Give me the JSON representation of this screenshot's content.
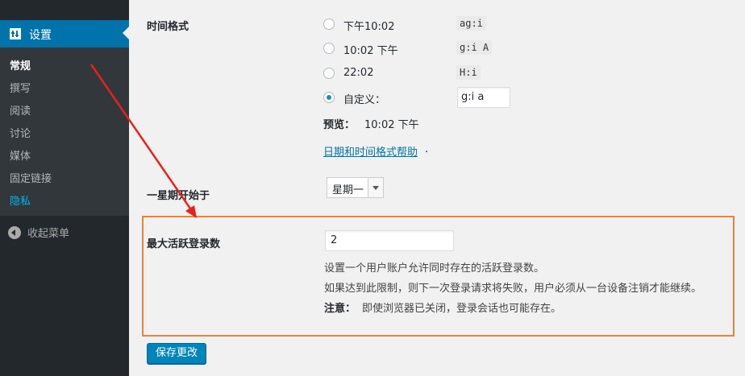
{
  "sidebar": {
    "settings_label": "设置",
    "items": [
      {
        "label": "常规"
      },
      {
        "label": "撰写"
      },
      {
        "label": "阅读"
      },
      {
        "label": "讨论"
      },
      {
        "label": "媒体"
      },
      {
        "label": "固定链接"
      },
      {
        "label": "隐私"
      }
    ],
    "collapse_label": "收起菜单"
  },
  "time_format": {
    "label": "时间格式",
    "options": [
      {
        "label": "下午10:02",
        "code": "ag:i",
        "checked": false
      },
      {
        "label": "10:02 下午",
        "code": "g:i A",
        "checked": false
      },
      {
        "label": "22:02",
        "code": "H:i",
        "checked": false
      },
      {
        "label": "自定义：",
        "code": "",
        "checked": true
      }
    ],
    "custom_value": "g:i a",
    "preview_label": "预览：",
    "preview_value": "10:02 下午",
    "help_link": "日期和时间格式帮助",
    "help_suffix": "."
  },
  "week_start": {
    "label": "一星期开始于",
    "selected": "星期一"
  },
  "max_logins": {
    "label": "最大活跃登录数",
    "value": "2",
    "desc1": "设置一个用户账户允许同时存在的活跃登录数。",
    "desc2": "如果达到此限制，则下一次登录请求将失败，用户必须从一台设备注销才能继续。",
    "note_label": "注意：",
    "note_text": "即使浏览器已关闭，登录会话也可能存在。"
  },
  "save_button": "保存更改",
  "colors": {
    "sidebar_bg": "#23282d",
    "accent": "#0073aa",
    "highlight_border": "#e8833a",
    "annotation_arrow": "#e8211a"
  }
}
